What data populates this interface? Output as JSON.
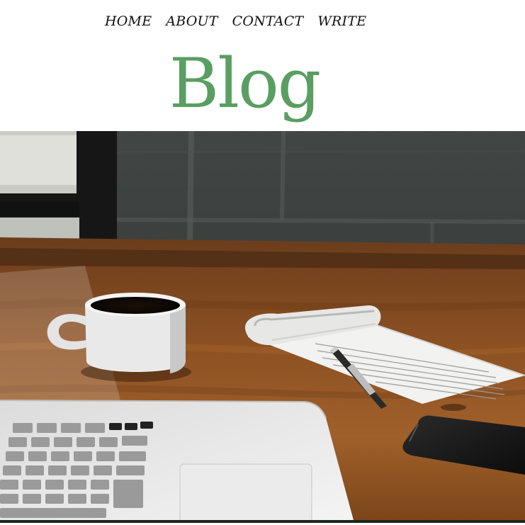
{
  "nav": {
    "items": [
      {
        "label": "HOME"
      },
      {
        "label": "ABOUT"
      },
      {
        "label": "CONTACT"
      },
      {
        "label": "WRITE"
      }
    ]
  },
  "header": {
    "title": "Blog",
    "title_color": "#5a9e62"
  },
  "hero": {
    "alt": "Desk with coffee cup, notepad with pen, laptop and phone"
  }
}
